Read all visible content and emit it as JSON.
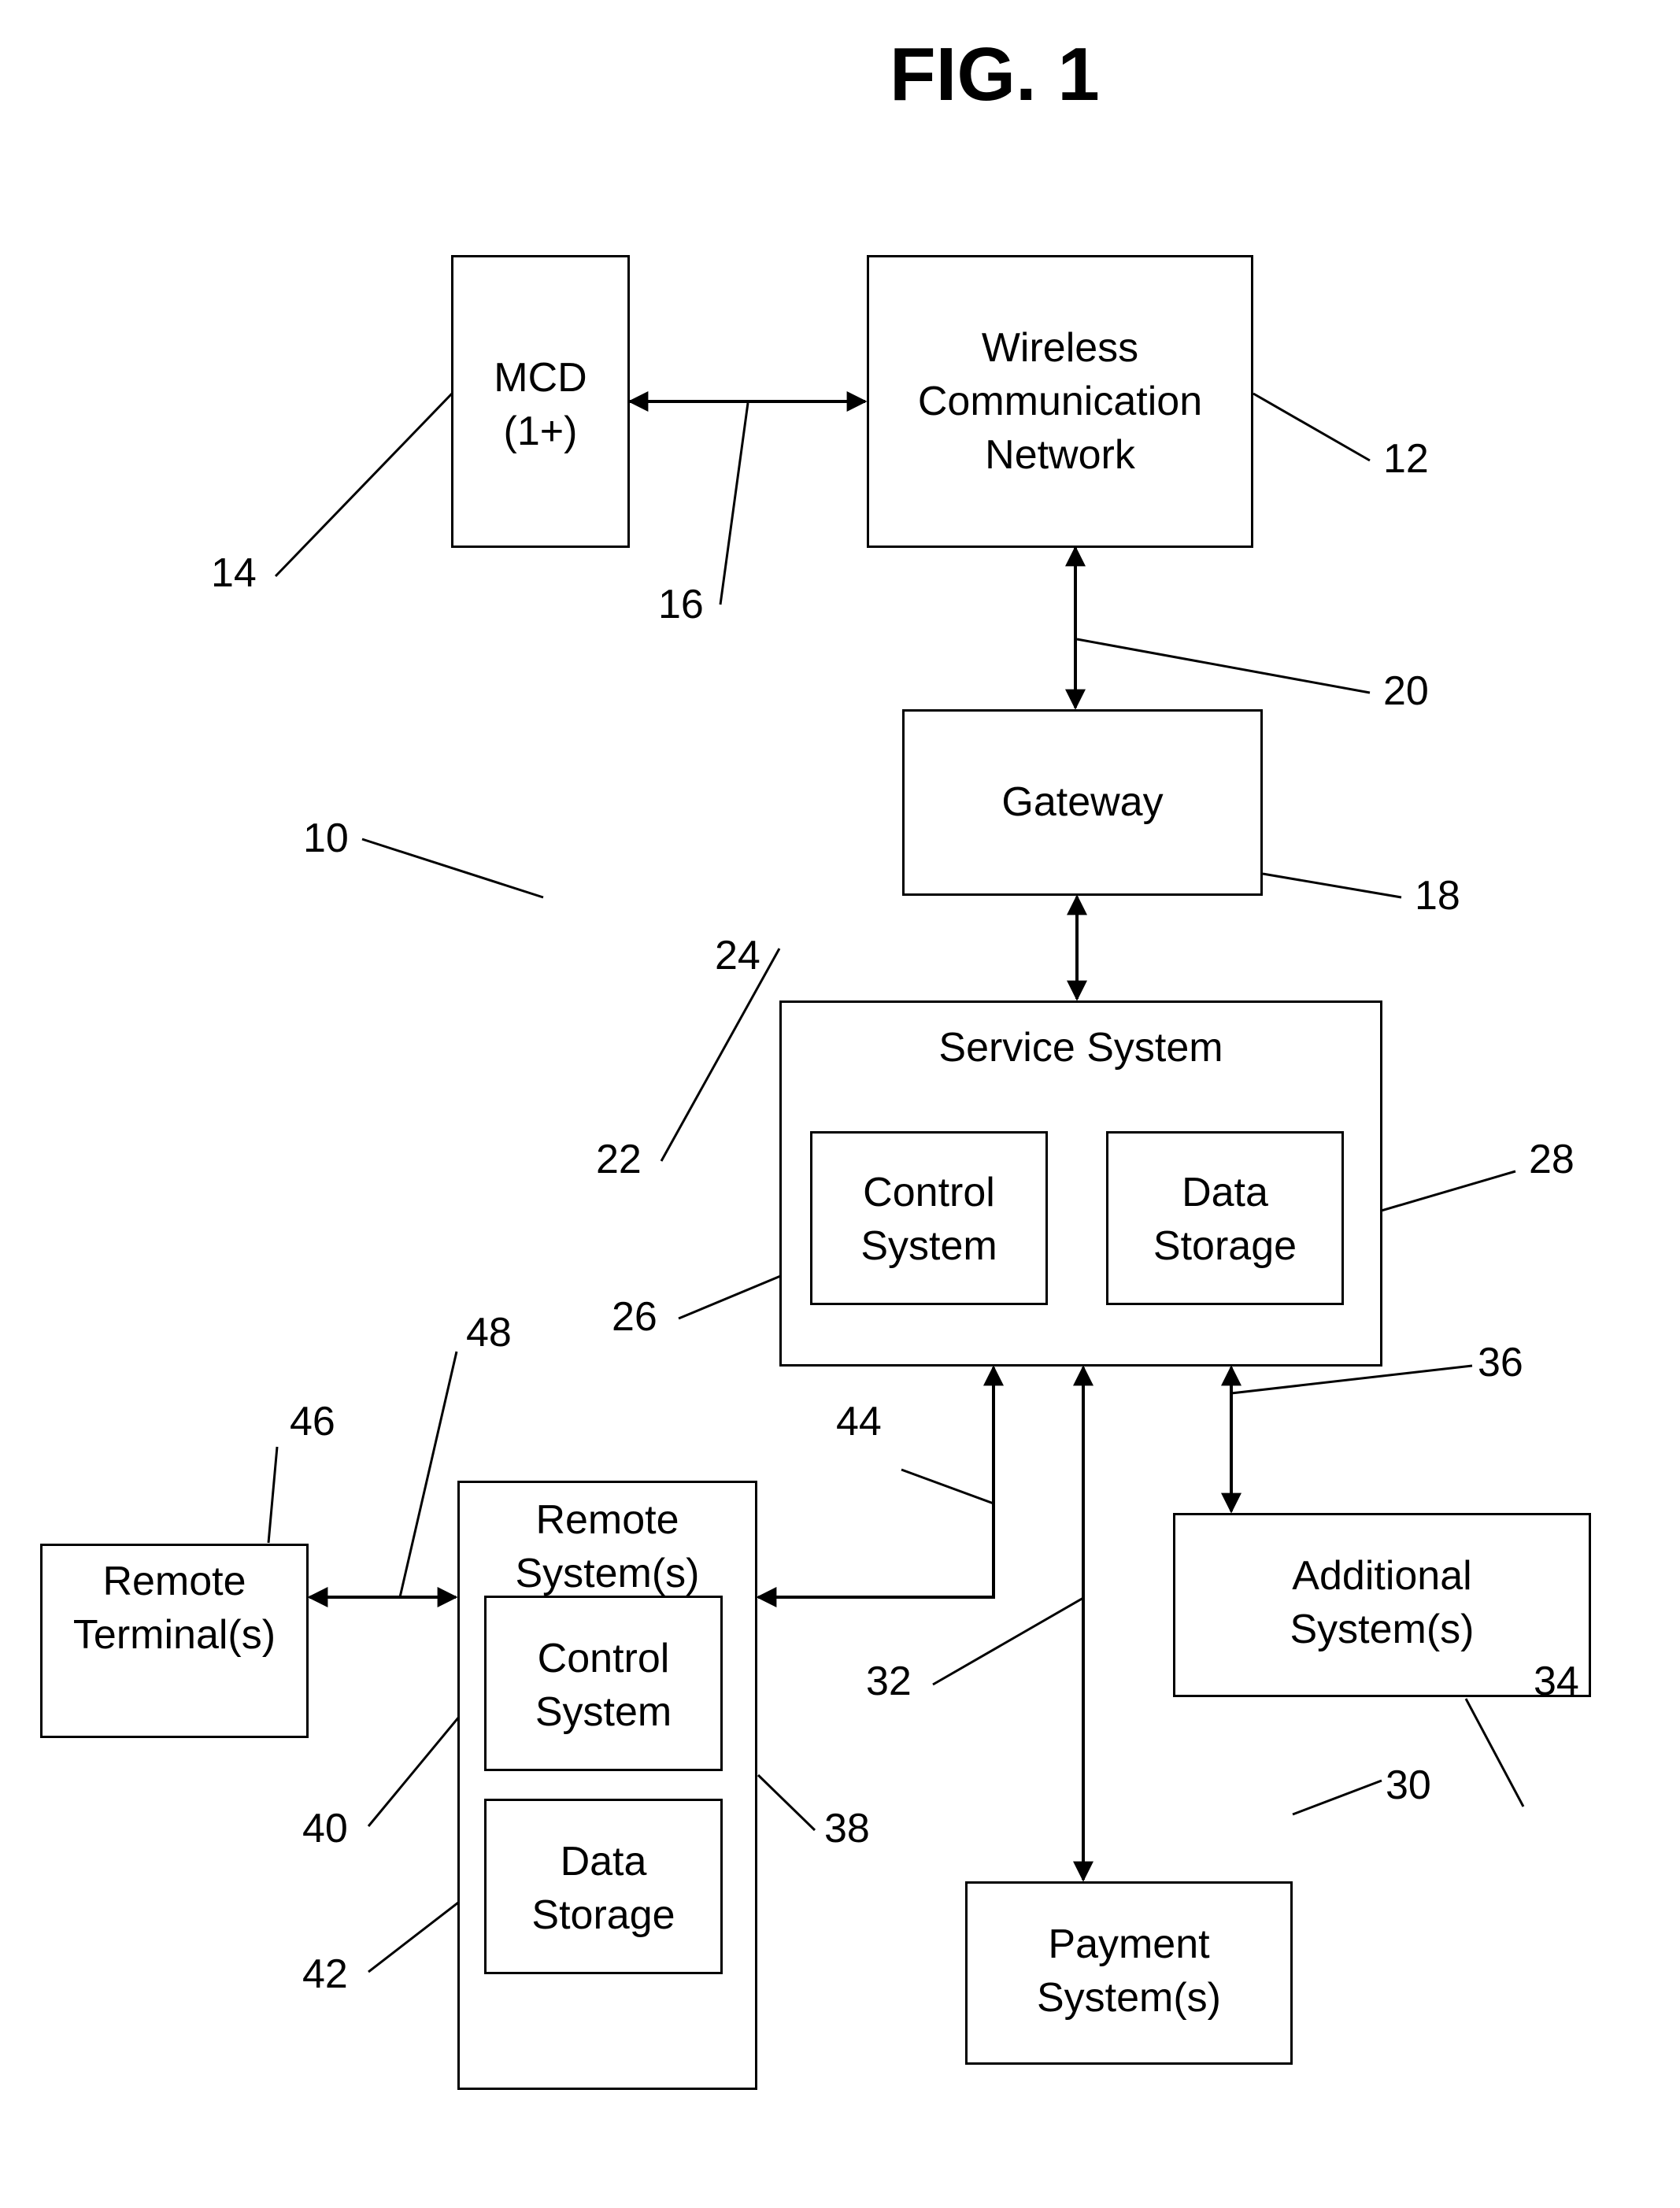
{
  "figure": {
    "title": "FIG. 1"
  },
  "blocks": {
    "mcd": {
      "lines": [
        "MCD",
        "(1+)"
      ],
      "ref": "14"
    },
    "wcn": {
      "lines": [
        "Wireless",
        "Communication",
        "Network"
      ],
      "ref": "12"
    },
    "gateway": {
      "lines": [
        "Gateway"
      ],
      "ref": "18"
    },
    "service": {
      "title": "Service System",
      "ref": "22"
    },
    "service_control": {
      "lines": [
        "Control",
        "System"
      ],
      "ref": "26"
    },
    "service_data": {
      "lines": [
        "Data",
        "Storage"
      ],
      "ref": "28"
    },
    "remote_terminal": {
      "lines": [
        "Remote",
        "Terminal(s)"
      ],
      "ref": "46"
    },
    "remote_system": {
      "title_lines": [
        "Remote",
        "System(s)"
      ],
      "ref": "38"
    },
    "remote_control": {
      "lines": [
        "Control",
        "System"
      ],
      "ref": "40"
    },
    "remote_data": {
      "lines": [
        "Data",
        "Storage"
      ],
      "ref": "42"
    },
    "additional": {
      "lines": [
        "Additional",
        "System(s)"
      ],
      "ref": "34"
    },
    "payment": {
      "lines": [
        "Payment",
        "System(s)"
      ],
      "ref": "30"
    }
  },
  "links": {
    "mcd_wcn": "16",
    "wcn_gateway": "20",
    "gateway_service": "24",
    "service_payment": "32",
    "service_additional": "36",
    "service_remote": "44",
    "terminal_remote": "48"
  },
  "system_ref": "10"
}
